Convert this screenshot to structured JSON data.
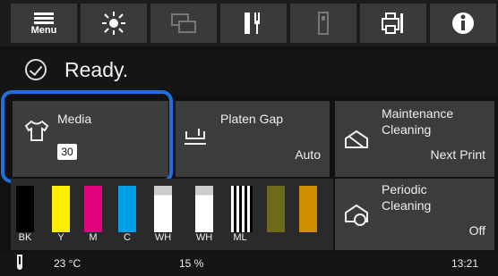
{
  "topbar": {
    "menu_label": "Menu",
    "buttons": [
      "menu-icon",
      "light-icon",
      "layers-icon",
      "fork-spoon-icon",
      "usb-icon",
      "printer-wrench-icon",
      "info-icon"
    ]
  },
  "status": {
    "text": "Ready."
  },
  "media": {
    "label": "Media",
    "number": "30"
  },
  "platen": {
    "label": "Platen Gap",
    "value": "Auto"
  },
  "maint": {
    "label1": "Maintenance",
    "label2": "Cleaning",
    "value": "Next Print"
  },
  "periodic": {
    "label1": "Periodic",
    "label2": "Cleaning",
    "value": "Off"
  },
  "inks": [
    {
      "label": "BK",
      "color": "#000000"
    },
    {
      "label": "Y",
      "color": "#ffee00"
    },
    {
      "label": "M",
      "color": "#e2007b"
    },
    {
      "label": "C",
      "color": "#00a0e9"
    },
    {
      "label": "WH",
      "color": "#ffffff"
    },
    {
      "label": "WH",
      "color": "#ffffff"
    },
    {
      "label": "ML",
      "color": "#dcdcdc"
    },
    {
      "label": "",
      "color": "#6e6a1a"
    },
    {
      "label": "",
      "color": "#d18f00"
    }
  ],
  "bottom": {
    "temp": "23 °C",
    "humidity": "15 %",
    "time": "13:21"
  }
}
